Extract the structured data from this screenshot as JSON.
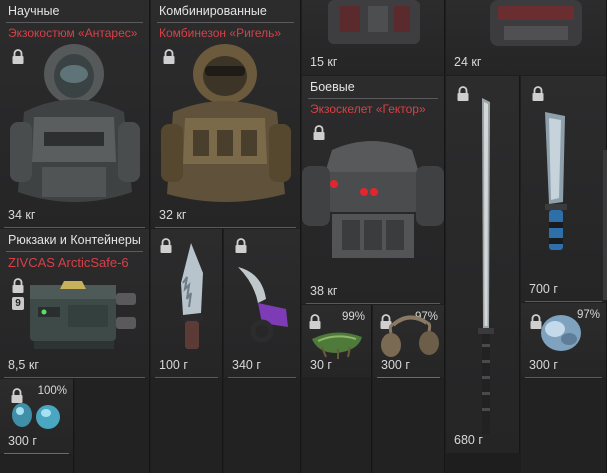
{
  "colors": {
    "background": "#1e1e1f",
    "cell": "#2b2b2c",
    "name_red": "#d84048",
    "accent_red_line": "#b2343b",
    "accent_blue_line": "#5d6c9e"
  },
  "items": [
    {
      "id": "anteres",
      "category": "Научные",
      "name": "Экзокостюм «Антарес»",
      "weight": "34 кг",
      "locked": true,
      "icon": "scientific-exosuit-image"
    },
    {
      "id": "rigel",
      "category": "Комбинированные",
      "name": "Комбинезон «Ригель»",
      "weight": "32 кг",
      "locked": true,
      "icon": "combined-suit-image"
    },
    {
      "id": "top-item-1",
      "weight": "15 кг",
      "icon": "armor-image"
    },
    {
      "id": "top-item-2",
      "weight": "24 кг",
      "icon": "armor-image"
    },
    {
      "id": "hector",
      "category": "Боевые",
      "name": "Экзоскелет «Гектор»",
      "weight": "38 кг",
      "locked": true,
      "icon": "combat-exoskeleton-image"
    },
    {
      "id": "katana",
      "weight": "680 г",
      "locked": true,
      "icon": "katana-image"
    },
    {
      "id": "blade",
      "weight": "700 г",
      "locked": true,
      "icon": "machete-image"
    },
    {
      "id": "arcticsafe",
      "category": "Рюкзаки и Контейнеры",
      "name": "ZIVCAS ArcticSafe-6",
      "weight": "8,5 кг",
      "locked": true,
      "badge": "9",
      "icon": "container-image"
    },
    {
      "id": "knife",
      "weight": "100 г",
      "locked": true,
      "icon": "serrated-knife-image"
    },
    {
      "id": "karambit",
      "weight": "340 г",
      "locked": true,
      "icon": "karambit-image"
    },
    {
      "id": "artifact-green",
      "weight": "30 г",
      "locked": true,
      "percent": "99%",
      "icon": "artifact-image"
    },
    {
      "id": "artifact-brown",
      "weight": "300 г",
      "locked": true,
      "percent": "97%",
      "icon": "artifact-image"
    },
    {
      "id": "artifact-blue",
      "weight": "300 г",
      "locked": true,
      "percent": "97%",
      "icon": "artifact-image"
    },
    {
      "id": "artifact-cyan",
      "weight": "300 г",
      "locked": true,
      "percent": "100%",
      "icon": "artifact-image"
    }
  ]
}
